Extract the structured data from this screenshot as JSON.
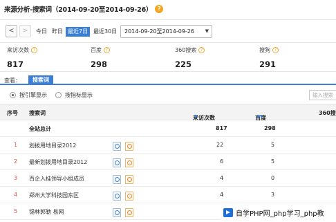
{
  "page": {
    "title": "来源分析-搜索词（2014-09-20至2014-09-26）",
    "help_badge": "?"
  },
  "toolbar": {
    "prev": "<",
    "next": ">",
    "ranges": [
      "今日",
      "昨日",
      "最近7日",
      "最近30日"
    ],
    "active_range": "最近7日",
    "date_range": "2014-09-20至2014-09-26",
    "dropdown_arrow": "▼"
  },
  "stats": [
    {
      "label": "来访次数",
      "value": "817"
    },
    {
      "label": "百度",
      "value": "298"
    },
    {
      "label": "360搜索",
      "value": "225"
    },
    {
      "label": "搜狗",
      "value": "291"
    }
  ],
  "view": {
    "label": "查看：",
    "tab": "搜索词"
  },
  "radios": [
    {
      "label": "按引擎显示",
      "checked": true
    },
    {
      "label": "按指标显示",
      "checked": false
    }
  ],
  "search": {
    "placeholder": "输入搜索"
  },
  "table": {
    "headers": {
      "index": "序号",
      "keyword": "搜索词",
      "visits": "来访次数",
      "baidu": "百度",
      "s360": "360搜"
    },
    "sort_arrow": "▼",
    "sort_both": "▲▼",
    "total": {
      "label": "全站总计",
      "visits": "817",
      "baidu": "298"
    },
    "rows": [
      {
        "index": "1",
        "keyword": "划拨用地目录2012",
        "visits": "22",
        "baidu": "5"
      },
      {
        "index": "2",
        "keyword": "最新划拨用地目录2012",
        "visits": "6",
        "baidu": "5"
      },
      {
        "index": "3",
        "keyword": "百企入桂领导小组成员",
        "visits": "4",
        "baidu": "0"
      },
      {
        "index": "4",
        "keyword": "郑州大学科技园东区",
        "visits": "4",
        "baidu": "3"
      },
      {
        "index": "5",
        "keyword": "锡林郭勒 易网",
        "visits": "",
        "baidu": ""
      }
    ]
  },
  "watermark": {
    "text": "自学PHP网_php学习_php教"
  }
}
